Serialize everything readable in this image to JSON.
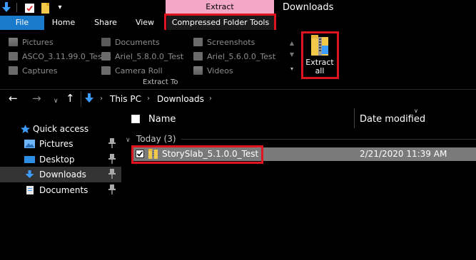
{
  "titlebar": {
    "context_header": "Extract",
    "window_title": "Downloads"
  },
  "ribbon_tabs": {
    "file": "File",
    "home": "Home",
    "share": "Share",
    "view": "View",
    "compressed_folder_tools": "Compressed Folder Tools"
  },
  "ribbon": {
    "extract_to_items": [
      "Pictures",
      "Documents",
      "Screenshots",
      "ASCO_3.11.99.0_Test",
      "Ariel_5.8.0.0_Test",
      "Ariel_5.6.0.0_Test",
      "Captures",
      "Camera Roll",
      "Videos"
    ],
    "group_label": "Extract To",
    "extract_all_line1": "Extract",
    "extract_all_line2": "all"
  },
  "address_bar": {
    "crumbs": [
      "This PC",
      "Downloads"
    ]
  },
  "nav_pane": {
    "quick_access": "Quick access",
    "items": [
      "Pictures",
      "Desktop",
      "Downloads",
      "Documents"
    ]
  },
  "file_list": {
    "col_name": "Name",
    "col_date": "Date modified",
    "group": "Today (3)",
    "rows": [
      {
        "name": "StorySlab_5.1.0.0_Test",
        "date": "2/21/2020 11:39 AM"
      }
    ]
  },
  "colors": {
    "file_tab": "#1979ca",
    "context_tab": "#f4a8c7",
    "highlight_box": "#e0141e",
    "selected_row": "#7a7a7a"
  }
}
